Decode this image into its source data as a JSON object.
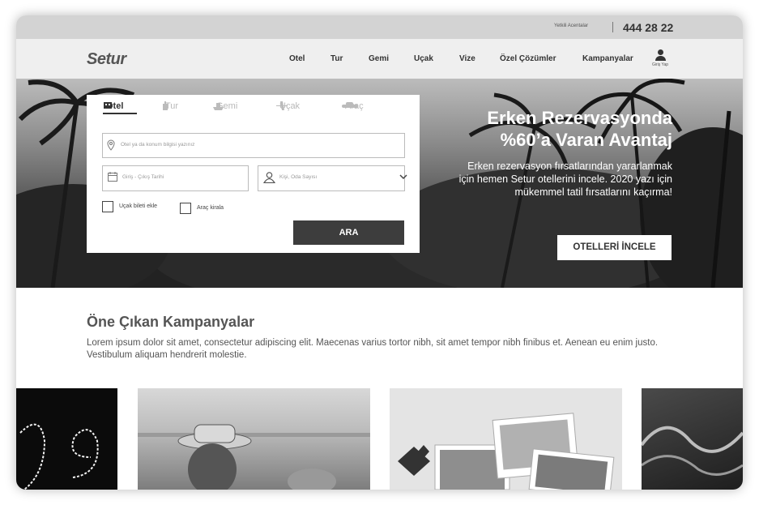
{
  "topbar": {
    "agents_label": "Yetkili Acentalar",
    "phone": "444 28 22"
  },
  "header": {
    "logo": "Setur",
    "nav": [
      "Otel",
      "Tur",
      "Gemi",
      "Uçak",
      "Vize",
      "Özel Çözümler",
      "Kampanyalar"
    ],
    "login_label": "Giriş Yap"
  },
  "search": {
    "tabs": [
      {
        "label": "Otel",
        "icon": "hotel-icon",
        "active": true
      },
      {
        "label": "Tur",
        "icon": "tour-icon",
        "active": false
      },
      {
        "label": "Gemi",
        "icon": "ship-icon",
        "active": false
      },
      {
        "label": "Uçak",
        "icon": "plane-icon",
        "active": false
      },
      {
        "label": "Araç",
        "icon": "car-icon",
        "active": false
      }
    ],
    "location_placeholder": "Otel ya da konum bilgisi yazınız",
    "dates_placeholder": "Giriş - Çıkış Tarihi",
    "guests_placeholder": "Kişi, Oda Sayısı",
    "add_flight_label": "Uçak bileti ekle",
    "rent_car_label": "Araç kirala",
    "submit_label": "ARA"
  },
  "promo": {
    "title_line1": "Erken Rezervasyonda",
    "title_line2": "%60’a Varan Avantaj",
    "description": "Erken rezervasyon fırsatlarından yararlanmak için hemen Setur otellerini incele. 2020 yazı için mükemmel tatil fırsatlarını kaçırma!",
    "button_label": "OTELLERİ İNCELE"
  },
  "featured": {
    "heading": "Öne Çıkan Kampanyalar",
    "description": "Lorem ipsum dolor sit amet, consectetur adipiscing elit. Maecenas varius tortor nibh, sit amet tempor nibh finibus et. Aenean eu enim justo. Vestibulum aliquam hendrerit molestie."
  },
  "colors": {
    "topbar": "#d3d3d3",
    "navbar": "#efefef",
    "button_dark": "#3d3d3d",
    "text": "#333333"
  }
}
